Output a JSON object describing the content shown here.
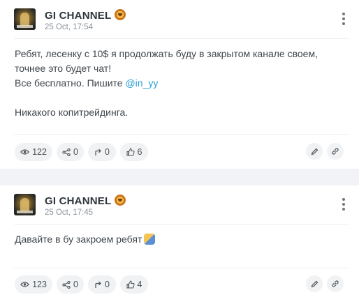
{
  "posts": [
    {
      "channel_name": "GI CHANNEL",
      "timestamp": "25 Oct, 17:54",
      "lines": [
        "Ребят, лесенку с 10$ я продолжать буду в закрытом канале своем,",
        "точнее это будет чат!",
        "Все бесплатно. Пишите ",
        "",
        "Никакого копитрейдинга."
      ],
      "mention": "@in_yy",
      "stats": {
        "views": "122",
        "shares": "0",
        "forwards": "0",
        "likes": "6"
      }
    },
    {
      "channel_name": "GI CHANNEL",
      "timestamp": "25 Oct, 17:45",
      "lines": [
        "Давайте в бу закроем ребят"
      ],
      "stats": {
        "views": "123",
        "shares": "0",
        "forwards": "0",
        "likes": "4"
      }
    }
  ],
  "icons": {
    "header": [
      "avatar-image",
      "lion-face-icon",
      "more-vertical-icon"
    ],
    "footer": [
      "eye-icon",
      "share-icon",
      "forward-arrow-icon",
      "thumbs-up-icon",
      "pencil-icon",
      "link-icon"
    ],
    "message": [
      "raising-hand-emoji-icon"
    ]
  },
  "colors": {
    "background": "#f1f3f6",
    "card": "#ffffff",
    "pill": "#f0f2f4",
    "mention": "#2a9fd6",
    "muted": "#8c949c"
  }
}
